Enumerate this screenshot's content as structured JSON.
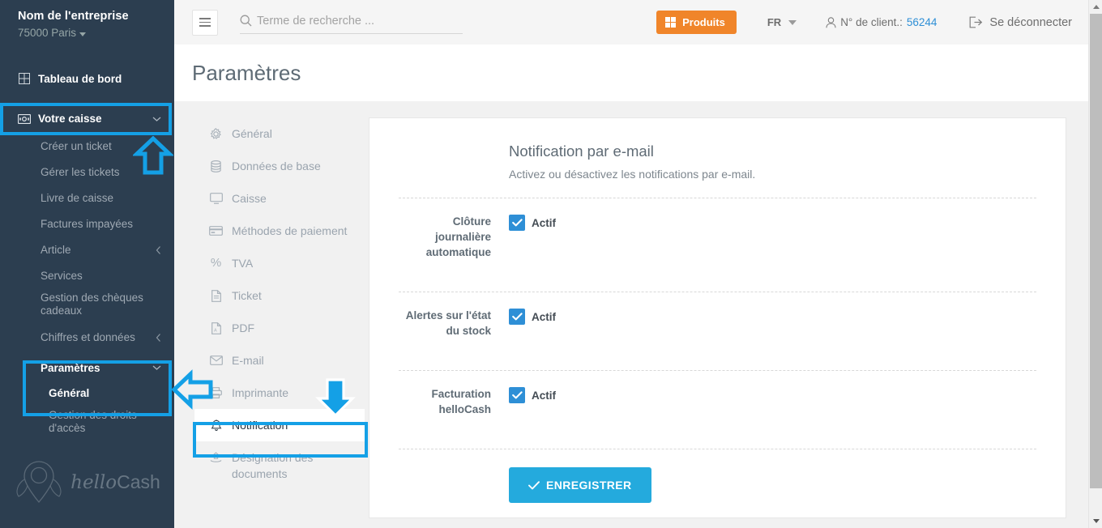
{
  "sidebar": {
    "brand": {
      "name": "Nom de l'entreprise",
      "location": "75000 Paris"
    },
    "dashboard": {
      "label": "Tableau de bord",
      "icon": "dashboard-grid-icon"
    },
    "cash": {
      "label": "Votre caisse",
      "icon": "cash-register-icon",
      "chevron": "chevron-down-icon"
    },
    "cash_items": [
      {
        "label": "Créer un ticket"
      },
      {
        "label": "Gérer les tickets"
      },
      {
        "label": "Livre de caisse"
      },
      {
        "label": "Factures impayées"
      },
      {
        "label": "Article",
        "chevron": "chevron-left-icon"
      },
      {
        "label": "Services"
      },
      {
        "label": "Gestion des chèques cadeaux"
      },
      {
        "label": "Chiffres et données",
        "chevron": "chevron-left-icon"
      }
    ],
    "settings": {
      "label": "Paramètres",
      "chevron": "chevron-down-icon"
    },
    "settings_items": [
      {
        "label": "Général",
        "active": true
      },
      {
        "label": "Gestion des droits d'accès",
        "active": false
      }
    ],
    "logo": {
      "word1": "hello",
      "word2": "Cash"
    }
  },
  "topbar": {
    "menu_toggle": "hamburger-menu-icon",
    "search": {
      "placeholder": "Terme de recherche ...",
      "value": "",
      "icon": "search-icon"
    },
    "products_button": {
      "label": "Produits",
      "icon": "grid-icon",
      "color": "#f0852a"
    },
    "language": {
      "value": "FR",
      "icon": "chevron-down-icon"
    },
    "client": {
      "label": "N° de client.:",
      "number": "56244",
      "icon": "user-icon"
    },
    "logout": {
      "label": "Se déconnecter",
      "icon": "logout-icon"
    }
  },
  "page": {
    "title": "Paramètres"
  },
  "settings_nav": [
    {
      "label": "Général",
      "icon": "gear-icon",
      "active": false
    },
    {
      "label": "Données de base",
      "icon": "database-icon",
      "active": false
    },
    {
      "label": "Caisse",
      "icon": "monitor-icon",
      "active": false
    },
    {
      "label": "Méthodes de paiement",
      "icon": "credit-card-icon",
      "active": false
    },
    {
      "label": "TVA",
      "icon": "percent-icon",
      "active": false
    },
    {
      "label": "Ticket",
      "icon": "file-icon",
      "active": false
    },
    {
      "label": "PDF",
      "icon": "pdf-file-icon",
      "active": false
    },
    {
      "label": "E-mail",
      "icon": "envelope-icon",
      "active": false
    },
    {
      "label": "Imprimante",
      "icon": "printer-icon",
      "active": false
    },
    {
      "label": "Notification",
      "icon": "bell-icon",
      "active": true
    },
    {
      "label": "Désignation des documents",
      "icon": "document-tag-icon",
      "active": false
    }
  ],
  "card": {
    "heading": "Notification par e-mail",
    "subheading": "Activez ou désactivez les notifications par e-mail.",
    "rows": [
      {
        "label": "Clôture journalière automatique",
        "checkbox_label": "Actif",
        "checked": true
      },
      {
        "label": "Alertes sur l'état du stock",
        "checkbox_label": "Actif",
        "checked": true
      },
      {
        "label": "Facturation helloCash",
        "checkbox_label": "Actif",
        "checked": true
      }
    ],
    "save_button": {
      "label": "ENREGISTRER",
      "icon": "check-icon",
      "color": "#24aadd"
    }
  },
  "annotations": {
    "highlight_color": "#14a0e6",
    "arrows": [
      {
        "name": "arrow-up-votre-caisse",
        "direction": "up"
      },
      {
        "name": "arrow-left-parametres-general",
        "direction": "left"
      },
      {
        "name": "arrow-down-notification",
        "direction": "down"
      }
    ]
  }
}
